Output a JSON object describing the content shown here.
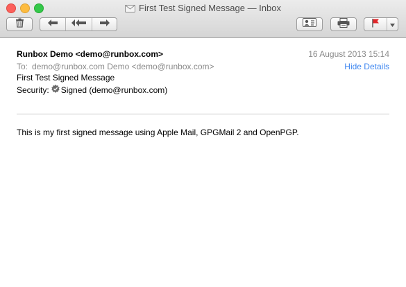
{
  "window": {
    "title": "First Test Signed Message — Inbox"
  },
  "toolbar": {
    "icons": [
      "trash-icon",
      "reply-icon",
      "reply-all-icon",
      "forward-icon",
      "address-card-icon",
      "print-icon",
      "flag-icon",
      "dropdown-arrow-icon"
    ],
    "flag_color": "#e0262a"
  },
  "message": {
    "from": "Runbox Demo <demo@runbox.com>",
    "date": "16 August 2013 15:14",
    "to_label": "To:",
    "to_value": "demo@runbox.com Demo <demo@runbox.com>",
    "hide_details": "Hide Details",
    "subject": "First Test Signed Message",
    "security_label": "Security:",
    "security_value": "Signed (demo@runbox.com)",
    "body": "This is my first signed message using Apple Mail, GPGMail 2 and OpenPGP."
  },
  "colors": {
    "link": "#3d86f0",
    "muted": "#8a8a8a"
  }
}
